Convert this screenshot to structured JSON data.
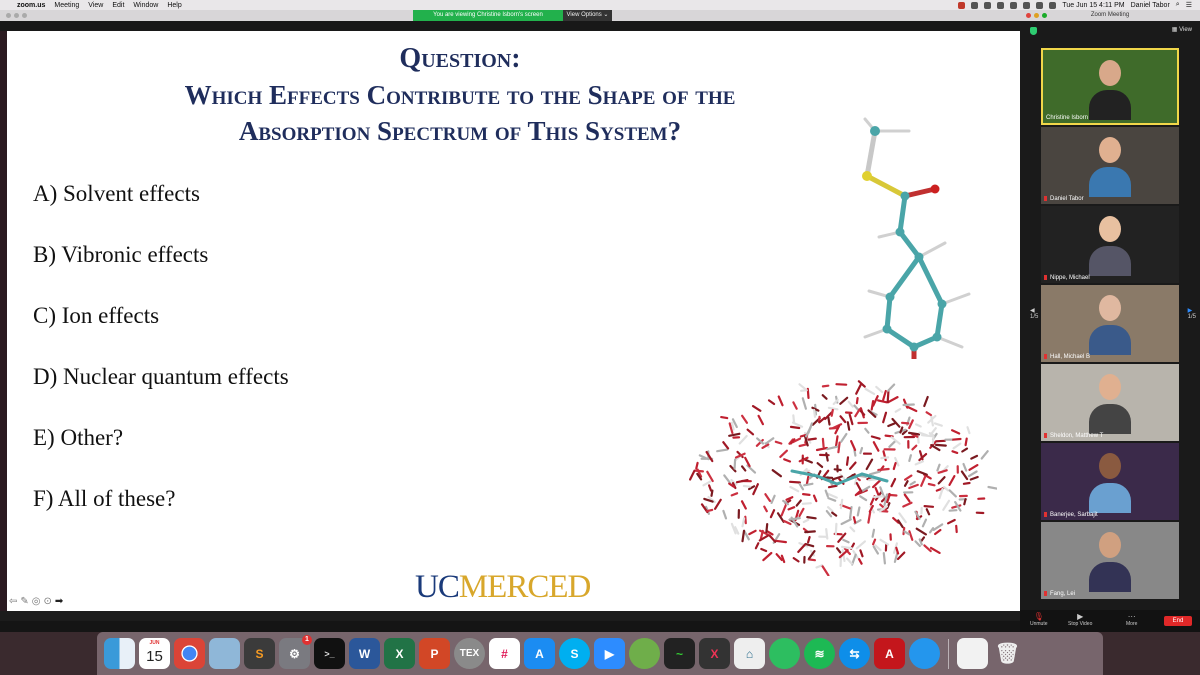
{
  "menubar": {
    "app_name": "zoom.us",
    "menus": [
      "Meeting",
      "View",
      "Edit",
      "Window",
      "Help"
    ],
    "clock": "Tue Jun 15  4:11 PM",
    "user": "Daniel Tabor"
  },
  "share": {
    "banner": "You are viewing Christine Isborn's screen",
    "view_options": "View Options"
  },
  "slide": {
    "question_heading": "Question:",
    "question_line1": "Which Effects Contribute to the Shape of the",
    "question_line2": "Absorption Spectrum of This System?",
    "answers": [
      "A) Solvent effects",
      "B) Vibronic effects",
      "C) Ion effects",
      "D) Nuclear quantum effects",
      "E) Other?",
      "F) All of these?"
    ],
    "logo_uc": "UC",
    "logo_merced": "MERCED"
  },
  "zoom": {
    "window_title": "Zoom Meeting",
    "view_label": "View",
    "page_left": "1/5",
    "page_right": "1/5",
    "participants": [
      {
        "name": "Christine Isborn",
        "active": true,
        "muted": false
      },
      {
        "name": "Daniel Tabor",
        "active": false,
        "muted": true
      },
      {
        "name": "Nippe, Michael",
        "active": false,
        "muted": true
      },
      {
        "name": "Hall, Michael B",
        "active": false,
        "muted": true
      },
      {
        "name": "Sheldon, Matthew T",
        "active": false,
        "muted": true
      },
      {
        "name": "Banerjee, Sarbajit",
        "active": false,
        "muted": true
      },
      {
        "name": "Fang, Lei",
        "active": false,
        "muted": true
      }
    ],
    "toolbar": {
      "unmute": "Unmute",
      "stop_video": "Stop Video",
      "more": "More",
      "end": "End"
    }
  },
  "dock": {
    "calendar_month": "JUN",
    "calendar_day": "15",
    "sysprefs_badge": "1",
    "apps": [
      "finder",
      "calendar",
      "chrome",
      "preview",
      "sublime",
      "system-preferences",
      "terminal",
      "word",
      "excel",
      "powerpoint",
      "tex",
      "slack",
      "app-store",
      "skype",
      "zoom",
      "network",
      "activity-monitor",
      "x11",
      "vesta",
      "evernote",
      "spotify",
      "teamviewer",
      "acrobat",
      "docker",
      "documents",
      "trash"
    ]
  },
  "colors": {
    "slide_title": "#1f2d5c",
    "uc_blue": "#1a3a7a",
    "merced_gold": "#d8a72b",
    "share_banner": "#22b14c",
    "active_speaker": "#f1d74a",
    "end_button": "#e02828"
  }
}
